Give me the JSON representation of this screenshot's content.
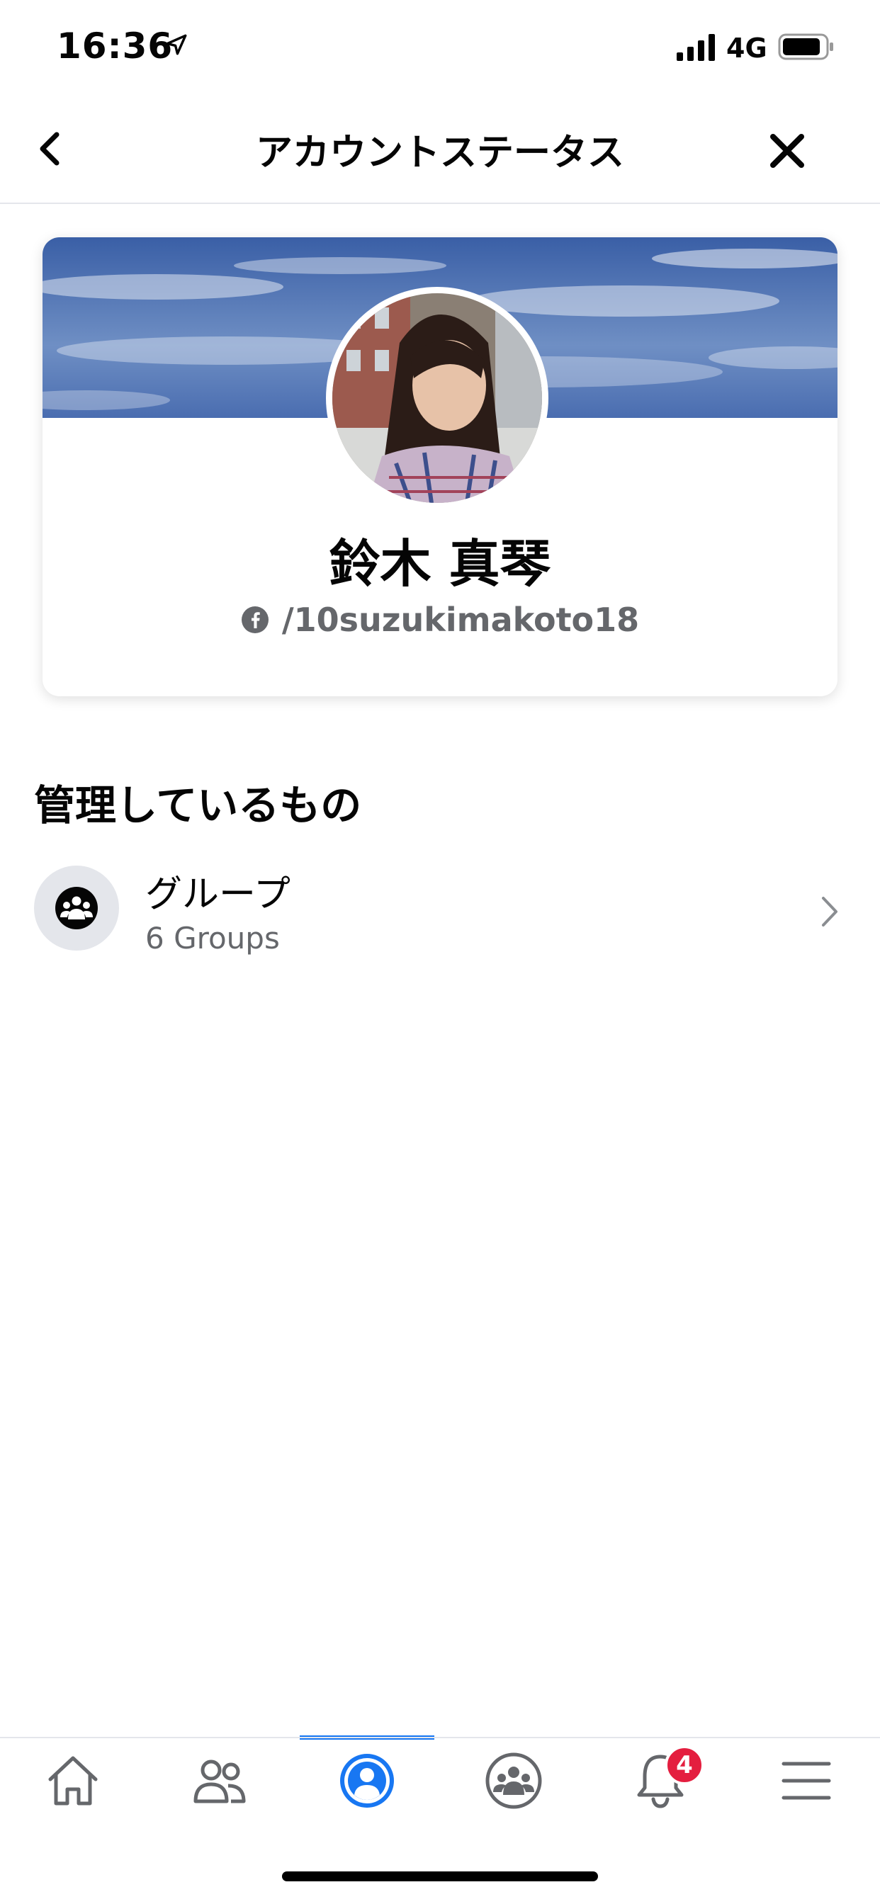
{
  "status_bar": {
    "time": "16:36",
    "network": "4G"
  },
  "header": {
    "title": "アカウントステータス"
  },
  "profile": {
    "name": "鈴木 真琴",
    "handle": "/10suzukimakoto18"
  },
  "managed": {
    "section_title": "管理しているもの",
    "items": [
      {
        "label": "グループ",
        "sublabel": "6 Groups",
        "icon": "group-icon"
      }
    ]
  },
  "tabbar": {
    "tabs": [
      {
        "name": "home",
        "icon": "home-icon",
        "active": false
      },
      {
        "name": "friends",
        "icon": "friends-icon",
        "active": false
      },
      {
        "name": "profile",
        "icon": "profile-icon",
        "active": true
      },
      {
        "name": "groups",
        "icon": "groups-icon",
        "active": false
      },
      {
        "name": "notifications",
        "icon": "bell-icon",
        "active": false,
        "badge": "4"
      },
      {
        "name": "menu",
        "icon": "menu-icon",
        "active": false
      }
    ]
  },
  "colors": {
    "accent": "#1877f2",
    "badge": "#e41e3f",
    "secondary_text": "#65676b",
    "icon_bg": "#e4e6eb"
  }
}
